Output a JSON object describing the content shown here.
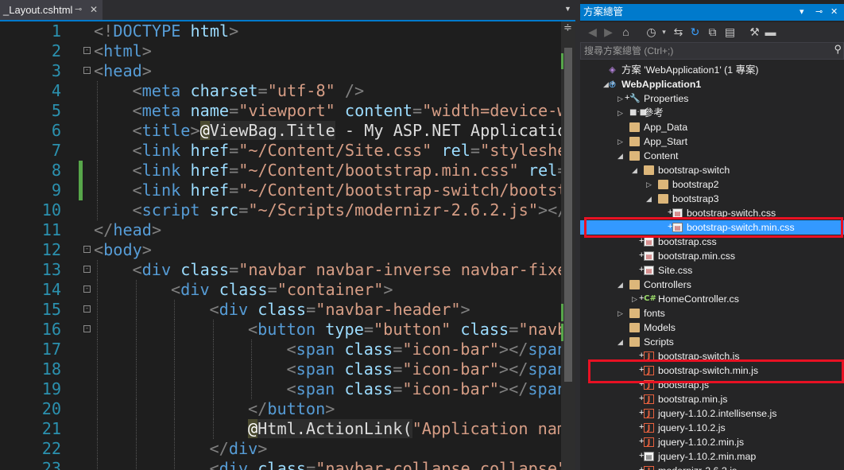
{
  "editor": {
    "tab_title": "_Layout.cshtml",
    "tab_pin_icon": "pin-icon",
    "tab_close_icon": "close-icon",
    "lines": [
      {
        "num": "1",
        "changed": false,
        "fold": "",
        "indent": 0,
        "tokens": [
          {
            "k": "p",
            "t": "<!"
          },
          {
            "k": "t",
            "t": "DOCTYPE"
          },
          {
            "k": "x",
            "t": " "
          },
          {
            "k": "a",
            "t": "html"
          },
          {
            "k": "p",
            "t": ">"
          }
        ]
      },
      {
        "num": "2",
        "changed": false,
        "fold": "-",
        "indent": 0,
        "tokens": [
          {
            "k": "p",
            "t": "<"
          },
          {
            "k": "t",
            "t": "html"
          },
          {
            "k": "p",
            "t": ">"
          }
        ]
      },
      {
        "num": "3",
        "changed": false,
        "fold": "-",
        "indent": 0,
        "tokens": [
          {
            "k": "p",
            "t": "<"
          },
          {
            "k": "t",
            "t": "head"
          },
          {
            "k": "p",
            "t": ">"
          }
        ]
      },
      {
        "num": "4",
        "changed": false,
        "fold": "",
        "indent": 1,
        "tokens": [
          {
            "k": "p",
            "t": "<"
          },
          {
            "k": "t",
            "t": "meta"
          },
          {
            "k": "x",
            "t": " "
          },
          {
            "k": "a",
            "t": "charset"
          },
          {
            "k": "p",
            "t": "="
          },
          {
            "k": "v",
            "t": "\"utf-8\""
          },
          {
            "k": "x",
            "t": " "
          },
          {
            "k": "p",
            "t": "/>"
          }
        ]
      },
      {
        "num": "5",
        "changed": false,
        "fold": "",
        "indent": 1,
        "tokens": [
          {
            "k": "p",
            "t": "<"
          },
          {
            "k": "t",
            "t": "meta"
          },
          {
            "k": "x",
            "t": " "
          },
          {
            "k": "a",
            "t": "name"
          },
          {
            "k": "p",
            "t": "="
          },
          {
            "k": "v",
            "t": "\"viewport\""
          },
          {
            "k": "x",
            "t": " "
          },
          {
            "k": "a",
            "t": "content"
          },
          {
            "k": "p",
            "t": "="
          },
          {
            "k": "v",
            "t": "\"width=device-w"
          }
        ]
      },
      {
        "num": "6",
        "changed": false,
        "fold": "",
        "indent": 1,
        "tokens": [
          {
            "k": "p",
            "t": "<"
          },
          {
            "k": "t",
            "t": "title"
          },
          {
            "k": "p",
            "t": ">"
          },
          {
            "k": "r",
            "t": "@"
          },
          {
            "k": "c",
            "t": "ViewBag.Title"
          },
          {
            "k": "x",
            "t": " - My ASP.NET Applicatio"
          }
        ]
      },
      {
        "num": "7",
        "changed": false,
        "fold": "",
        "indent": 1,
        "tokens": [
          {
            "k": "p",
            "t": "<"
          },
          {
            "k": "t",
            "t": "link"
          },
          {
            "k": "x",
            "t": " "
          },
          {
            "k": "a",
            "t": "href"
          },
          {
            "k": "p",
            "t": "="
          },
          {
            "k": "v",
            "t": "\"~/Content/Site.css\""
          },
          {
            "k": "x",
            "t": " "
          },
          {
            "k": "a",
            "t": "rel"
          },
          {
            "k": "p",
            "t": "="
          },
          {
            "k": "v",
            "t": "\"styleshe"
          }
        ]
      },
      {
        "num": "8",
        "changed": true,
        "fold": "",
        "indent": 1,
        "tokens": [
          {
            "k": "p",
            "t": "<"
          },
          {
            "k": "t",
            "t": "link"
          },
          {
            "k": "x",
            "t": " "
          },
          {
            "k": "a",
            "t": "href"
          },
          {
            "k": "p",
            "t": "="
          },
          {
            "k": "v",
            "t": "\"~/Content/bootstrap.min.css\""
          },
          {
            "k": "x",
            "t": " "
          },
          {
            "k": "a",
            "t": "rel"
          },
          {
            "k": "p",
            "t": "="
          }
        ]
      },
      {
        "num": "9",
        "changed": true,
        "fold": "",
        "indent": 1,
        "tokens": [
          {
            "k": "p",
            "t": "<"
          },
          {
            "k": "t",
            "t": "link"
          },
          {
            "k": "x",
            "t": " "
          },
          {
            "k": "a",
            "t": "href"
          },
          {
            "k": "p",
            "t": "="
          },
          {
            "k": "v",
            "t": "\"~/Content/bootstrap-switch/bootst"
          }
        ]
      },
      {
        "num": "10",
        "changed": false,
        "fold": "",
        "indent": 1,
        "tokens": [
          {
            "k": "p",
            "t": "<"
          },
          {
            "k": "t",
            "t": "script"
          },
          {
            "k": "x",
            "t": " "
          },
          {
            "k": "a",
            "t": "src"
          },
          {
            "k": "p",
            "t": "="
          },
          {
            "k": "v",
            "t": "\"~/Scripts/modernizr-2.6.2.js\""
          },
          {
            "k": "p",
            "t": "></"
          }
        ]
      },
      {
        "num": "11",
        "changed": false,
        "fold": "",
        "indent": 0,
        "tokens": [
          {
            "k": "p",
            "t": "</"
          },
          {
            "k": "t",
            "t": "head"
          },
          {
            "k": "p",
            "t": ">"
          }
        ]
      },
      {
        "num": "12",
        "changed": false,
        "fold": "-",
        "indent": 0,
        "tokens": [
          {
            "k": "p",
            "t": "<"
          },
          {
            "k": "t",
            "t": "body"
          },
          {
            "k": "p",
            "t": ">"
          }
        ]
      },
      {
        "num": "13",
        "changed": false,
        "fold": "-",
        "indent": 1,
        "tokens": [
          {
            "k": "p",
            "t": "<"
          },
          {
            "k": "t",
            "t": "div"
          },
          {
            "k": "x",
            "t": " "
          },
          {
            "k": "a",
            "t": "class"
          },
          {
            "k": "p",
            "t": "="
          },
          {
            "k": "v",
            "t": "\"navbar navbar-inverse navbar-fixe"
          }
        ]
      },
      {
        "num": "14",
        "changed": false,
        "fold": "-",
        "indent": 2,
        "tokens": [
          {
            "k": "p",
            "t": "<"
          },
          {
            "k": "t",
            "t": "div"
          },
          {
            "k": "x",
            "t": " "
          },
          {
            "k": "a",
            "t": "class"
          },
          {
            "k": "p",
            "t": "="
          },
          {
            "k": "v",
            "t": "\"container\""
          },
          {
            "k": "p",
            "t": ">"
          }
        ]
      },
      {
        "num": "15",
        "changed": false,
        "fold": "-",
        "indent": 3,
        "tokens": [
          {
            "k": "p",
            "t": "<"
          },
          {
            "k": "t",
            "t": "div"
          },
          {
            "k": "x",
            "t": " "
          },
          {
            "k": "a",
            "t": "class"
          },
          {
            "k": "p",
            "t": "="
          },
          {
            "k": "v",
            "t": "\"navbar-header\""
          },
          {
            "k": "p",
            "t": ">"
          }
        ]
      },
      {
        "num": "16",
        "changed": false,
        "fold": "-",
        "indent": 4,
        "tokens": [
          {
            "k": "p",
            "t": "<"
          },
          {
            "k": "t",
            "t": "button"
          },
          {
            "k": "x",
            "t": " "
          },
          {
            "k": "a",
            "t": "type"
          },
          {
            "k": "p",
            "t": "="
          },
          {
            "k": "v",
            "t": "\"button\""
          },
          {
            "k": "x",
            "t": " "
          },
          {
            "k": "a",
            "t": "class"
          },
          {
            "k": "p",
            "t": "="
          },
          {
            "k": "v",
            "t": "\"navb"
          }
        ]
      },
      {
        "num": "17",
        "changed": false,
        "fold": "",
        "indent": 5,
        "tokens": [
          {
            "k": "p",
            "t": "<"
          },
          {
            "k": "t",
            "t": "span"
          },
          {
            "k": "x",
            "t": " "
          },
          {
            "k": "a",
            "t": "class"
          },
          {
            "k": "p",
            "t": "="
          },
          {
            "k": "v",
            "t": "\"icon-bar\""
          },
          {
            "k": "p",
            "t": "></"
          },
          {
            "k": "t",
            "t": "span"
          }
        ]
      },
      {
        "num": "18",
        "changed": false,
        "fold": "",
        "indent": 5,
        "tokens": [
          {
            "k": "p",
            "t": "<"
          },
          {
            "k": "t",
            "t": "span"
          },
          {
            "k": "x",
            "t": " "
          },
          {
            "k": "a",
            "t": "class"
          },
          {
            "k": "p",
            "t": "="
          },
          {
            "k": "v",
            "t": "\"icon-bar\""
          },
          {
            "k": "p",
            "t": "></"
          },
          {
            "k": "t",
            "t": "span"
          }
        ]
      },
      {
        "num": "19",
        "changed": false,
        "fold": "",
        "indent": 5,
        "tokens": [
          {
            "k": "p",
            "t": "<"
          },
          {
            "k": "t",
            "t": "span"
          },
          {
            "k": "x",
            "t": " "
          },
          {
            "k": "a",
            "t": "class"
          },
          {
            "k": "p",
            "t": "="
          },
          {
            "k": "v",
            "t": "\"icon-bar\""
          },
          {
            "k": "p",
            "t": "></"
          },
          {
            "k": "t",
            "t": "span"
          }
        ]
      },
      {
        "num": "20",
        "changed": false,
        "fold": "",
        "indent": 4,
        "tokens": [
          {
            "k": "p",
            "t": "</"
          },
          {
            "k": "t",
            "t": "button"
          },
          {
            "k": "p",
            "t": ">"
          }
        ]
      },
      {
        "num": "21",
        "changed": false,
        "fold": "",
        "indent": 4,
        "tokens": [
          {
            "k": "r",
            "t": "@"
          },
          {
            "k": "c",
            "t": "Html.ActionLink("
          },
          {
            "k": "v",
            "t": "\"Application nam"
          }
        ]
      },
      {
        "num": "22",
        "changed": false,
        "fold": "",
        "indent": 3,
        "tokens": [
          {
            "k": "p",
            "t": "</"
          },
          {
            "k": "t",
            "t": "div"
          },
          {
            "k": "p",
            "t": ">"
          }
        ]
      },
      {
        "num": "23",
        "changed": false,
        "fold": "",
        "indent": 3,
        "tokens": [
          {
            "k": "p",
            "t": "<"
          },
          {
            "k": "t",
            "t": "div"
          },
          {
            "k": "x",
            "t": " "
          },
          {
            "k": "a",
            "t": "class"
          },
          {
            "k": "p",
            "t": "="
          },
          {
            "k": "v",
            "t": "\"navbar-collapse collapse\""
          }
        ]
      }
    ]
  },
  "solution_explorer": {
    "title": "方案總管",
    "title_buttons": [
      "dropdown-icon",
      "pin-icon",
      "close-icon"
    ],
    "toolbar_icons": [
      "back-icon",
      "forward-icon",
      "home-icon",
      "history-icon",
      "sync-icon",
      "refresh-icon",
      "collapse-all-icon",
      "show-all-files-icon",
      "properties-icon",
      "preview-icon"
    ],
    "search_placeholder": "搜尋方案總管 (Ctrl+;)",
    "tree": [
      {
        "depth": 0,
        "arrow": "",
        "plus": false,
        "icon": "solution",
        "label": "方案 'WebApplication1' (1 專案)",
        "bold": false,
        "selected": false
      },
      {
        "depth": 0,
        "arrow": "open",
        "plus": true,
        "icon": "web",
        "label": "WebApplication1",
        "bold": true,
        "selected": false
      },
      {
        "depth": 1,
        "arrow": "closed",
        "plus": true,
        "icon": "wrench",
        "label": "Properties",
        "bold": false,
        "selected": false
      },
      {
        "depth": 1,
        "arrow": "closed",
        "plus": false,
        "icon": "refs",
        "label": "參考",
        "bold": false,
        "selected": false
      },
      {
        "depth": 1,
        "arrow": "",
        "plus": false,
        "icon": "folder",
        "label": "App_Data",
        "bold": false,
        "selected": false
      },
      {
        "depth": 1,
        "arrow": "closed",
        "plus": false,
        "icon": "folder",
        "label": "App_Start",
        "bold": false,
        "selected": false
      },
      {
        "depth": 1,
        "arrow": "open",
        "plus": false,
        "icon": "folder",
        "label": "Content",
        "bold": false,
        "selected": false
      },
      {
        "depth": 2,
        "arrow": "open",
        "plus": false,
        "icon": "folder",
        "label": "bootstrap-switch",
        "bold": false,
        "selected": false
      },
      {
        "depth": 3,
        "arrow": "closed",
        "plus": false,
        "icon": "folder",
        "label": "bootstrap2",
        "bold": false,
        "selected": false
      },
      {
        "depth": 3,
        "arrow": "open",
        "plus": false,
        "icon": "folder",
        "label": "bootstrap3",
        "bold": false,
        "selected": false
      },
      {
        "depth": 4,
        "arrow": "",
        "plus": true,
        "icon": "file-css",
        "label": "bootstrap-switch.css",
        "bold": false,
        "selected": false
      },
      {
        "depth": 4,
        "arrow": "",
        "plus": true,
        "icon": "file-css",
        "label": "bootstrap-switch.min.css",
        "bold": false,
        "selected": true
      },
      {
        "depth": 2,
        "arrow": "",
        "plus": true,
        "icon": "file-css",
        "label": "bootstrap.css",
        "bold": false,
        "selected": false
      },
      {
        "depth": 2,
        "arrow": "",
        "plus": true,
        "icon": "file-css",
        "label": "bootstrap.min.css",
        "bold": false,
        "selected": false
      },
      {
        "depth": 2,
        "arrow": "",
        "plus": true,
        "icon": "file-css",
        "label": "Site.css",
        "bold": false,
        "selected": false
      },
      {
        "depth": 1,
        "arrow": "open",
        "plus": false,
        "icon": "folder",
        "label": "Controllers",
        "bold": false,
        "selected": false
      },
      {
        "depth": 2,
        "arrow": "closed",
        "plus": true,
        "icon": "cs",
        "label": "HomeController.cs",
        "bold": false,
        "selected": false
      },
      {
        "depth": 1,
        "arrow": "closed",
        "plus": false,
        "icon": "folder",
        "label": "fonts",
        "bold": false,
        "selected": false
      },
      {
        "depth": 1,
        "arrow": "",
        "plus": false,
        "icon": "folder",
        "label": "Models",
        "bold": false,
        "selected": false
      },
      {
        "depth": 1,
        "arrow": "open",
        "plus": false,
        "icon": "folder",
        "label": "Scripts",
        "bold": false,
        "selected": false
      },
      {
        "depth": 2,
        "arrow": "",
        "plus": true,
        "icon": "file-js",
        "label": "bootstrap-switch.js",
        "bold": false,
        "selected": false
      },
      {
        "depth": 2,
        "arrow": "",
        "plus": true,
        "icon": "file-js",
        "label": "bootstrap-switch.min.js",
        "bold": false,
        "selected": false
      },
      {
        "depth": 2,
        "arrow": "",
        "plus": true,
        "icon": "file-js",
        "label": "bootstrap.js",
        "bold": false,
        "selected": false
      },
      {
        "depth": 2,
        "arrow": "",
        "plus": true,
        "icon": "file-js",
        "label": "bootstrap.min.js",
        "bold": false,
        "selected": false
      },
      {
        "depth": 2,
        "arrow": "",
        "plus": true,
        "icon": "file-js",
        "label": "jquery-1.10.2.intellisense.js",
        "bold": false,
        "selected": false
      },
      {
        "depth": 2,
        "arrow": "",
        "plus": true,
        "icon": "file-js",
        "label": "jquery-1.10.2.js",
        "bold": false,
        "selected": false
      },
      {
        "depth": 2,
        "arrow": "",
        "plus": true,
        "icon": "file-js",
        "label": "jquery-1.10.2.min.js",
        "bold": false,
        "selected": false
      },
      {
        "depth": 2,
        "arrow": "",
        "plus": true,
        "icon": "file-map",
        "label": "jquery-1.10.2.min.map",
        "bold": false,
        "selected": false
      },
      {
        "depth": 2,
        "arrow": "",
        "plus": true,
        "icon": "file-js",
        "label": "modernizr-2.6.2.js",
        "bold": false,
        "selected": false
      }
    ],
    "highlight_color": "#e81123",
    "selection_color": "#3399ff",
    "accent_color": "#007acc"
  }
}
